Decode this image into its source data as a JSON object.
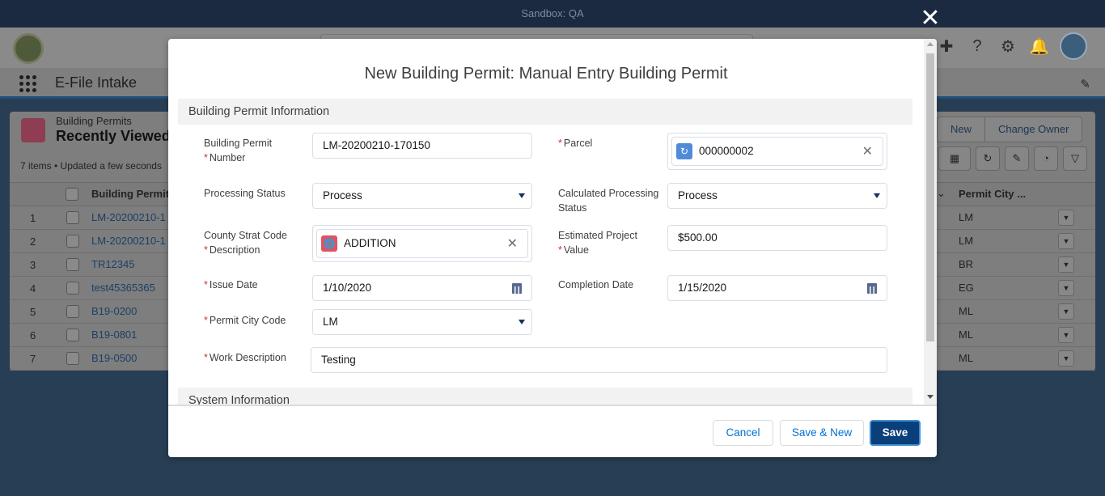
{
  "sandbox": {
    "label": "Sandbox: QA"
  },
  "nav": {
    "app_name": "E-File Intake"
  },
  "list": {
    "object_label": "Building Permits",
    "view_title": "Recently Viewed",
    "meta": "7 items • Updated a few seconds",
    "buttons": [
      "New",
      "Change Owner"
    ],
    "columns": {
      "name": "Building Permit",
      "city": "Permit City ..."
    },
    "rows": [
      {
        "num": "1",
        "name": "LM-20200210-1",
        "city": "LM"
      },
      {
        "num": "2",
        "name": "LM-20200210-1",
        "city": "LM"
      },
      {
        "num": "3",
        "name": "TR12345",
        "city": "BR"
      },
      {
        "num": "4",
        "name": "test45365365",
        "city": "EG"
      },
      {
        "num": "5",
        "name": "B19-0200",
        "city": "ML"
      },
      {
        "num": "6",
        "name": "B19-0801",
        "city": "ML"
      },
      {
        "num": "7",
        "name": "B19-0500",
        "city": "ML"
      }
    ]
  },
  "modal": {
    "title": "New Building Permit: Manual Entry Building Permit",
    "section1": "Building Permit Information",
    "section2": "System Information",
    "fields": {
      "permit_number": {
        "label1": "Building Permit",
        "label2": "Number",
        "value": "LM-20200210-170150"
      },
      "parcel": {
        "label": "Parcel",
        "value": "000000002"
      },
      "processing_status": {
        "label": "Processing Status",
        "value": "Process"
      },
      "calc_processing_status": {
        "label1": "Calculated Processing",
        "label2": "Status",
        "value": "Process"
      },
      "county_strat": {
        "label1": "County Strat Code",
        "label2": "Description",
        "value": "ADDITION"
      },
      "est_value": {
        "label1": "Estimated Project",
        "label2": "Value",
        "value": "$500.00"
      },
      "issue_date": {
        "label": "Issue Date",
        "value": "1/10/2020"
      },
      "completion_date": {
        "label": "Completion Date",
        "value": "1/15/2020"
      },
      "permit_city_code": {
        "label": "Permit City Code",
        "value": "LM"
      },
      "work_description": {
        "label": "Work Description",
        "value": "Testing"
      }
    },
    "footer": {
      "cancel": "Cancel",
      "save_new": "Save & New",
      "save": "Save"
    }
  },
  "colors": {
    "brand": "#0a3f7a",
    "required": "#c23934",
    "parcel_icon": "#4f8bd8",
    "strat_icon": "#e3525f"
  },
  "icons": [
    "close-icon",
    "search-icon",
    "add-icon",
    "help-icon",
    "gear-icon",
    "bell-icon",
    "calendar-icon",
    "chevron-down-icon",
    "parcel-icon",
    "globe-icon"
  ]
}
